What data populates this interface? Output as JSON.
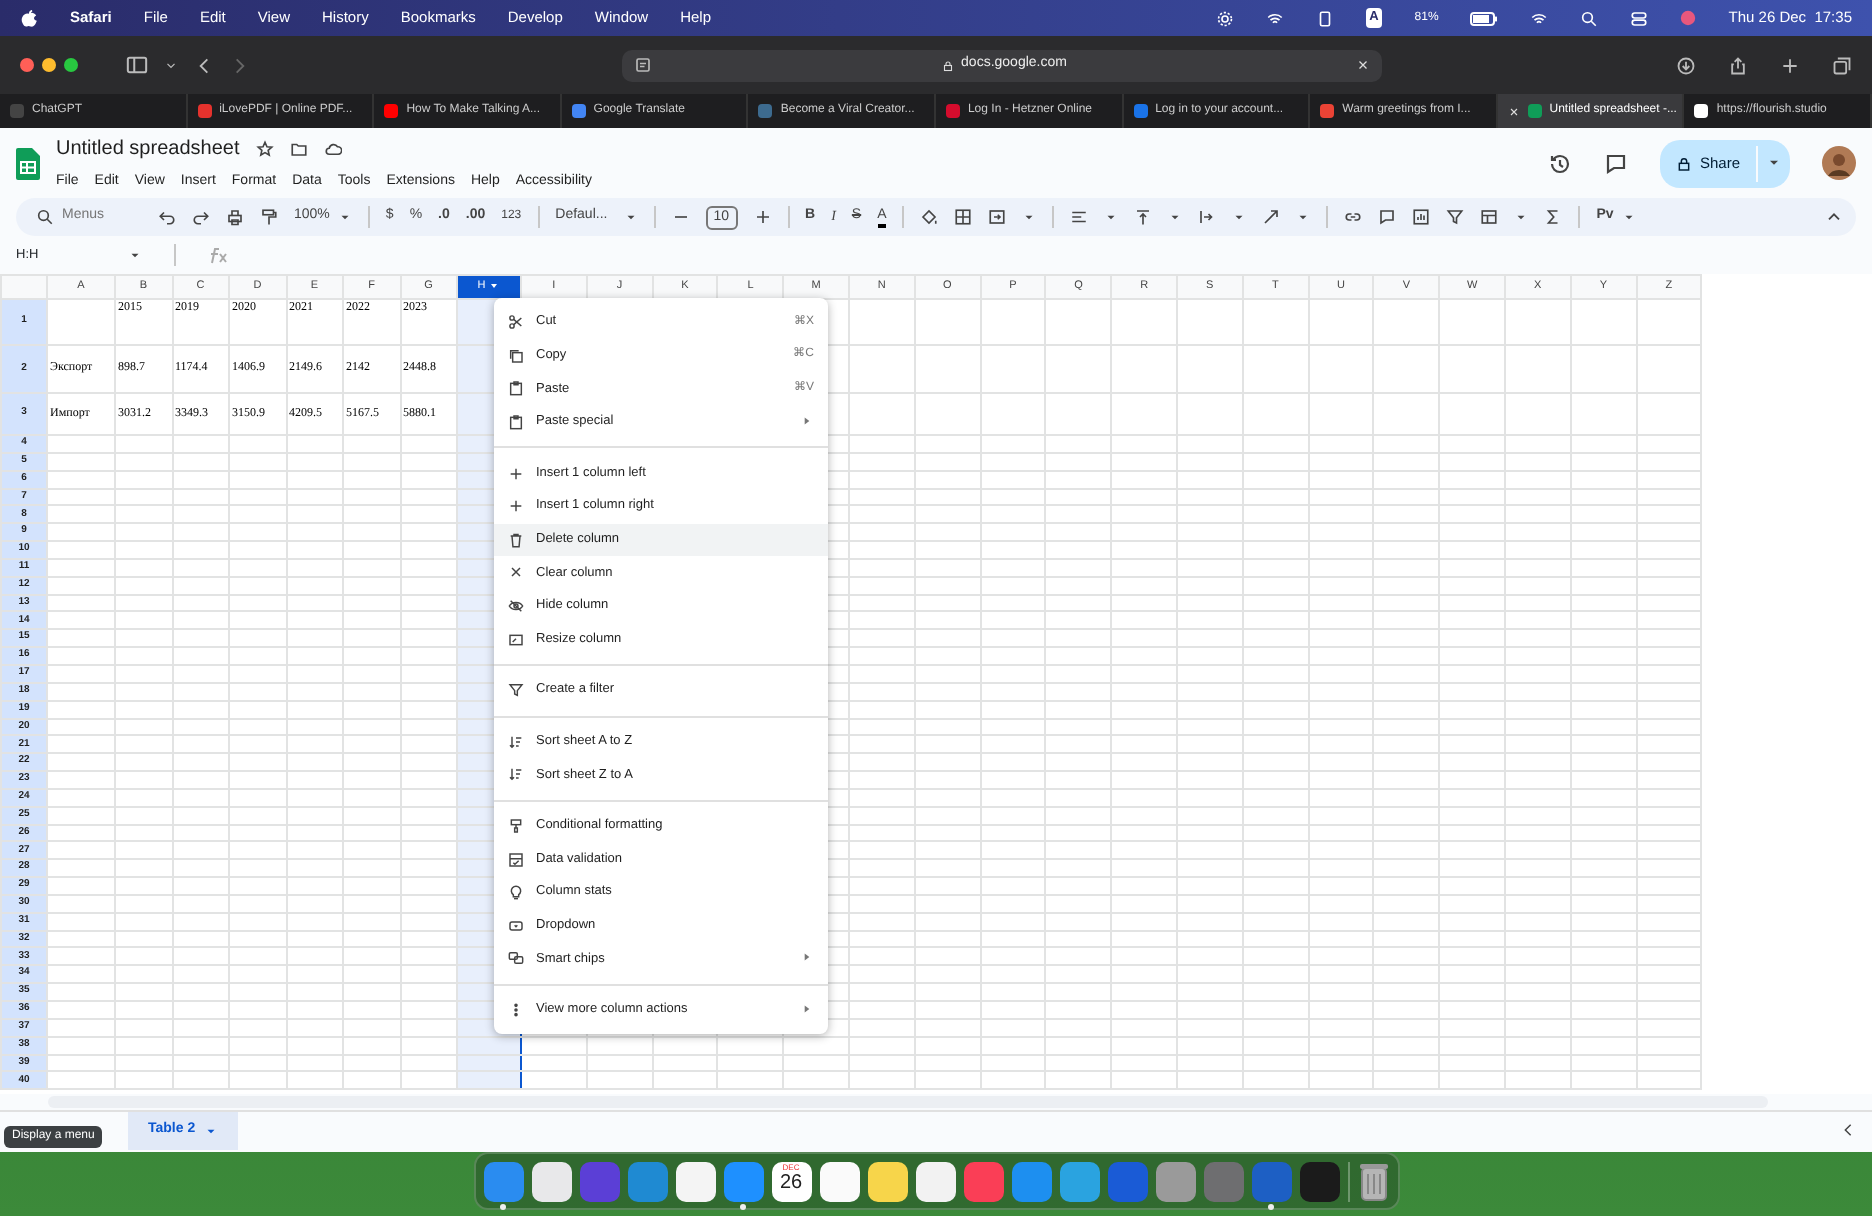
{
  "menubar": {
    "app": "Safari",
    "menus": [
      "File",
      "Edit",
      "View",
      "History",
      "Bookmarks",
      "Develop",
      "Window",
      "Help"
    ],
    "input_source": "A",
    "battery": "81%",
    "clock": "Thu 26 Dec  17:35"
  },
  "browser": {
    "address": "docs.google.com",
    "tabs": [
      {
        "title": "ChatGPT",
        "selected": false,
        "color": "#444444"
      },
      {
        "title": "iLovePDF | Online PDF...",
        "selected": false,
        "color": "#e5322d"
      },
      {
        "title": "How To Make Talking A...",
        "selected": false,
        "color": "#ff0000"
      },
      {
        "title": "Google Translate",
        "selected": false,
        "color": "#4285f4"
      },
      {
        "title": "Become a Viral Creator...",
        "selected": false,
        "color": "#3d6b8f"
      },
      {
        "title": "Log In - Hetzner Online",
        "selected": false,
        "color": "#d50c2d"
      },
      {
        "title": "Log in to your account...",
        "selected": false,
        "color": "#1a73e8"
      },
      {
        "title": "Warm greetings from I...",
        "selected": false,
        "color": "#ea4335"
      },
      {
        "title": "Untitled spreadsheet -...",
        "selected": true,
        "color": "#0f9d58"
      },
      {
        "title": "https://flourish.studio",
        "selected": false,
        "color": "#ffffff"
      }
    ]
  },
  "sheets": {
    "title": "Untitled spreadsheet",
    "menus": [
      "File",
      "Edit",
      "View",
      "Insert",
      "Format",
      "Data",
      "Tools",
      "Extensions",
      "Help",
      "Accessibility"
    ],
    "share": "Share",
    "toolbar": {
      "search_placeholder": "Menus",
      "zoom": "100%",
      "currency": "$",
      "percent": "%",
      "decrease_decimal": ".0",
      "increase_decimal": ".00",
      "number_format": "123",
      "font": "Defaul...",
      "font_size": "10",
      "bold": "B",
      "italic": "I",
      "strikethrough": "S",
      "text_color": "A",
      "input_tools": "Pv"
    },
    "name_box": "H:H",
    "columns": [
      {
        "label": "A",
        "selected": false
      },
      {
        "label": "B",
        "selected": false
      },
      {
        "label": "C",
        "selected": false
      },
      {
        "label": "D",
        "selected": false
      },
      {
        "label": "E",
        "selected": false
      },
      {
        "label": "F",
        "selected": false
      },
      {
        "label": "G",
        "selected": false
      },
      {
        "label": "H",
        "selected": true
      },
      {
        "label": "I",
        "selected": false
      },
      {
        "label": "J",
        "selected": false
      },
      {
        "label": "K",
        "selected": false
      },
      {
        "label": "L",
        "selected": false
      },
      {
        "label": "M",
        "selected": false
      },
      {
        "label": "N",
        "selected": false
      },
      {
        "label": "O",
        "selected": false
      },
      {
        "label": "P",
        "selected": false
      },
      {
        "label": "Q",
        "selected": false
      },
      {
        "label": "R",
        "selected": false
      },
      {
        "label": "S",
        "selected": false
      },
      {
        "label": "T",
        "selected": false
      },
      {
        "label": "U",
        "selected": false
      },
      {
        "label": "V",
        "selected": false
      },
      {
        "label": "W",
        "selected": false
      },
      {
        "label": "X",
        "selected": false
      },
      {
        "label": "Y",
        "selected": false
      },
      {
        "label": "Z",
        "selected": false
      }
    ],
    "rows": [
      {
        "number": "1",
        "values": [
          "2015",
          "2019",
          "2020",
          "2021",
          "2022",
          "2023"
        ]
      },
      {
        "number": "2",
        "label": "Экспорт",
        "values": [
          "898.7",
          "1174.4",
          "1406.9",
          "2149.6",
          "2142",
          "2448.8"
        ]
      },
      {
        "number": "3",
        "label": "Импорт",
        "values": [
          "3031.2",
          "3349.3",
          "3150.9",
          "4209.5",
          "5167.5",
          "5880.1"
        ]
      },
      {
        "number": "4"
      },
      {
        "number": "5"
      },
      {
        "number": "6"
      },
      {
        "number": "7"
      },
      {
        "number": "8"
      },
      {
        "number": "9"
      },
      {
        "number": "10"
      },
      {
        "number": "11"
      },
      {
        "number": "12"
      },
      {
        "number": "13"
      },
      {
        "number": "14"
      },
      {
        "number": "15"
      },
      {
        "number": "16"
      },
      {
        "number": "17"
      },
      {
        "number": "18"
      },
      {
        "number": "19"
      },
      {
        "number": "20"
      },
      {
        "number": "21"
      },
      {
        "number": "22"
      },
      {
        "number": "23"
      },
      {
        "number": "24"
      },
      {
        "number": "25"
      },
      {
        "number": "26"
      },
      {
        "number": "27"
      },
      {
        "number": "28"
      },
      {
        "number": "29"
      },
      {
        "number": "30"
      },
      {
        "number": "31"
      },
      {
        "number": "32"
      },
      {
        "number": "33"
      },
      {
        "number": "34"
      },
      {
        "number": "35"
      },
      {
        "number": "36"
      },
      {
        "number": "37"
      },
      {
        "number": "38"
      },
      {
        "number": "39"
      },
      {
        "number": "40"
      }
    ],
    "context_menu": [
      [
        {
          "label": "Cut",
          "shortcut": "⌘X",
          "submenu": false,
          "highlighted": false
        },
        {
          "label": "Copy",
          "shortcut": "⌘C",
          "submenu": false,
          "highlighted": false
        },
        {
          "label": "Paste",
          "shortcut": "⌘V",
          "submenu": false,
          "highlighted": false
        },
        {
          "label": "Paste special",
          "submenu": true,
          "highlighted": false
        }
      ],
      [
        {
          "label": "Insert 1 column left",
          "submenu": false,
          "highlighted": false
        },
        {
          "label": "Insert 1 column right",
          "submenu": false,
          "highlighted": false
        },
        {
          "label": "Delete column",
          "submenu": false,
          "highlighted": true
        },
        {
          "label": "Clear column",
          "submenu": false,
          "highlighted": false
        },
        {
          "label": "Hide column",
          "submenu": false,
          "highlighted": false
        },
        {
          "label": "Resize column",
          "submenu": false,
          "highlighted": false
        }
      ],
      [
        {
          "label": "Create a filter",
          "submenu": false,
          "highlighted": false
        }
      ],
      [
        {
          "label": "Sort sheet A to Z",
          "submenu": false,
          "highlighted": false
        },
        {
          "label": "Sort sheet Z to A",
          "submenu": false,
          "highlighted": false
        }
      ],
      [
        {
          "label": "Conditional formatting",
          "submenu": false,
          "highlighted": false
        },
        {
          "label": "Data validation",
          "submenu": false,
          "highlighted": false
        },
        {
          "label": "Column stats",
          "submenu": false,
          "highlighted": false
        },
        {
          "label": "Dropdown",
          "submenu": false,
          "highlighted": false
        },
        {
          "label": "Smart chips",
          "submenu": true,
          "highlighted": false
        }
      ],
      [
        {
          "label": "View more column actions",
          "submenu": true,
          "highlighted": false
        }
      ]
    ],
    "sheet_tabs": [
      {
        "label": "Table 2",
        "selected": true
      }
    ],
    "tooltip": "Display a menu"
  },
  "dock": [
    {
      "kind": "app",
      "color": "#2a8cf0",
      "running": true
    },
    {
      "kind": "app",
      "color": "#e8e8ea",
      "running": false
    },
    {
      "kind": "app",
      "color": "#5b3fd6",
      "running": false
    },
    {
      "kind": "app",
      "color": "#1f8ad2",
      "running": false
    },
    {
      "kind": "app",
      "color": "#f4f4f4",
      "running": false
    },
    {
      "kind": "app",
      "color": "#1e90ff",
      "running": true
    },
    {
      "kind": "calendar",
      "month": "DEC",
      "day": "26",
      "running": false
    },
    {
      "kind": "app",
      "color": "#fafafa",
      "running": false
    },
    {
      "kind": "app",
      "color": "#f7d54a",
      "running": false
    },
    {
      "kind": "app",
      "color": "#f2f2f2",
      "running": false
    },
    {
      "kind": "app",
      "color": "#fa3e56",
      "running": false
    },
    {
      "kind": "app",
      "color": "#1d8ff0",
      "running": false
    },
    {
      "kind": "app",
      "color": "#2aa3e0",
      "running": false
    },
    {
      "kind": "app",
      "color": "#1a5bd6",
      "running": false
    },
    {
      "kind": "app",
      "color": "#9a9a9a",
      "running": false
    },
    {
      "kind": "app",
      "color": "#6e6e70",
      "running": false
    },
    {
      "kind": "app",
      "color": "#1d5fc4",
      "running": true
    },
    {
      "kind": "app",
      "color": "#1b1b1b",
      "running": false
    },
    {
      "kind": "trash",
      "running": false
    }
  ]
}
